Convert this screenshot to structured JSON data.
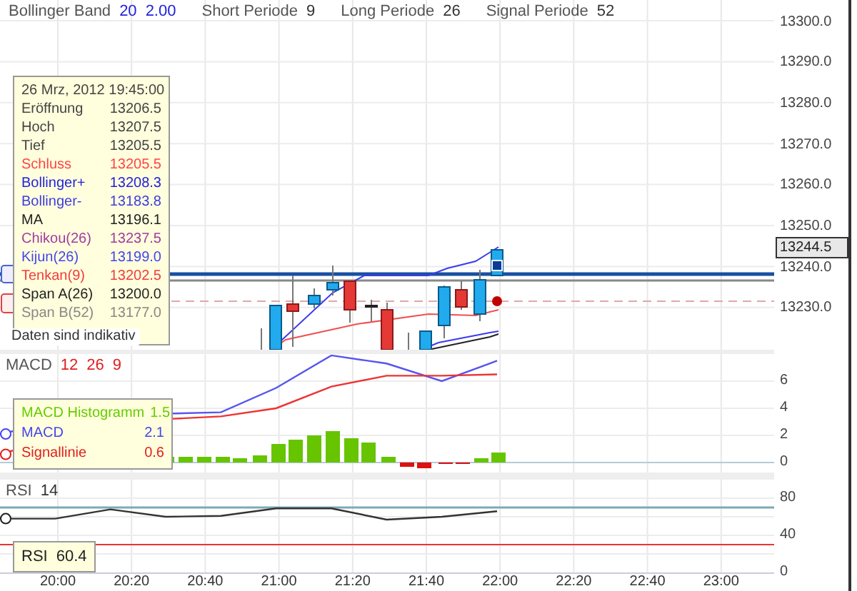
{
  "header": [
    {
      "label": "Bollinger Band",
      "values": [
        "20",
        "2.00"
      ],
      "color": "#2222dd"
    },
    {
      "label": "Short Periode",
      "values": [
        "9"
      ],
      "color": "#333333"
    },
    {
      "label": "Long Periode",
      "values": [
        "26"
      ],
      "color": "#333333"
    },
    {
      "label": "Signal Periode",
      "values": [
        "52"
      ],
      "color": "#333333"
    }
  ],
  "price_axis": [
    "13300.0",
    "13290.0",
    "13280.0",
    "13270.0",
    "13260.0",
    "13250.0",
    "13240.0",
    "13230.0"
  ],
  "last_price": "13244.5",
  "price_tooltip": {
    "date": "26 Mrz, 2012 19:45:00",
    "rows": [
      {
        "label": "Eröffnung",
        "value": "13206.5",
        "color": "#444444"
      },
      {
        "label": "Hoch",
        "value": "13207.5",
        "color": "#444444"
      },
      {
        "label": "Tief",
        "value": "13205.5",
        "color": "#444444"
      },
      {
        "label": "Schluss",
        "value": "13205.5",
        "color": "#ff4444"
      },
      {
        "label": "Bollinger+",
        "value": "13208.3",
        "color": "#2222dd"
      },
      {
        "label": "Bollinger-",
        "value": "13183.8",
        "color": "#3d3de0"
      },
      {
        "label": "MA",
        "value": "13196.1",
        "color": "#222222"
      },
      {
        "label": "Chikou(26)",
        "value": "13237.5",
        "color": "#a03ca0"
      },
      {
        "label": "Kijun(26)",
        "value": "13199.0",
        "color": "#4444ee"
      },
      {
        "label": "Tenkan(9)",
        "value": "13202.5",
        "color": "#f03c3c"
      },
      {
        "label": "Span A(26)",
        "value": "13200.0",
        "color": "#222222"
      },
      {
        "label": "Span B(52)",
        "value": "13177.0",
        "color": "#888888"
      }
    ]
  },
  "disclaimer": "Daten sind indikativ",
  "macd": {
    "label": "MACD",
    "values": [
      "12",
      "26",
      "9"
    ],
    "color": "#e02020",
    "tooltip": [
      {
        "label": "MACD Histogramm",
        "value": "1.5",
        "color": "#66cc00"
      },
      {
        "label": "MACD",
        "value": "2.1",
        "color": "#4444ee"
      },
      {
        "label": "Signallinie",
        "value": "0.6",
        "color": "#e02020"
      }
    ],
    "axis_labels": [
      "6",
      "4",
      "2",
      "0"
    ]
  },
  "rsi": {
    "label": "RSI",
    "values": [
      "14"
    ],
    "color": "#333333",
    "tooltip": {
      "label": "RSI",
      "value": "60.4"
    },
    "axis_labels": [
      "80",
      "40",
      "0"
    ]
  },
  "time_axis": [
    "20:00",
    "20:20",
    "20:40",
    "21:00",
    "21:20",
    "21:40",
    "22:00",
    "22:20",
    "22:40",
    "23:00"
  ]
}
